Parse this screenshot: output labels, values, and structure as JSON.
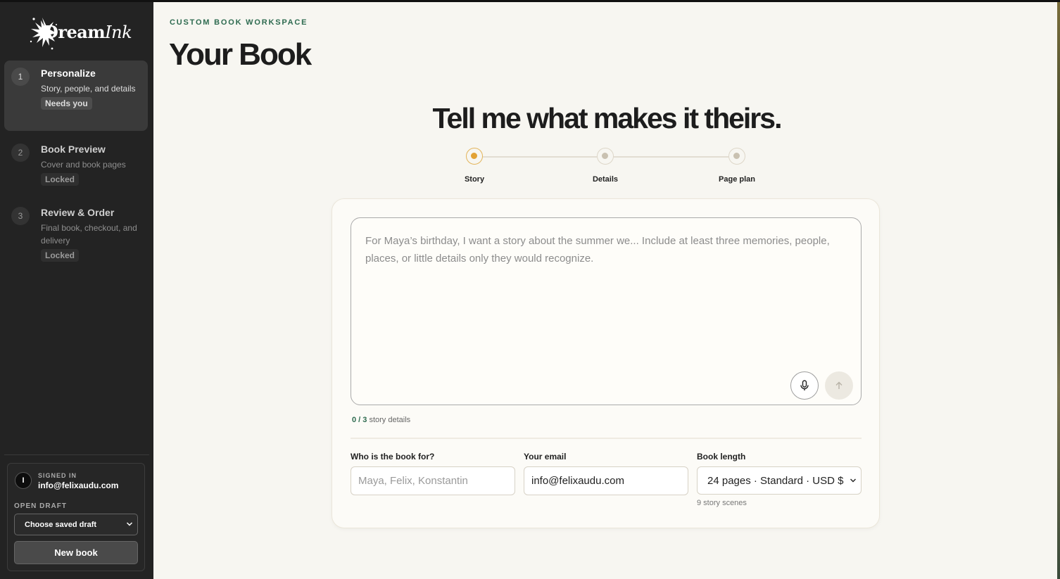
{
  "brand": {
    "name_bold": "Dream",
    "name_italic": "Ink"
  },
  "steps": [
    {
      "number": "1",
      "title": "Personalize",
      "desc": "Story, people, and details",
      "badge": "Needs you"
    },
    {
      "number": "2",
      "title": "Book Preview",
      "desc": "Cover and book pages",
      "badge": "Locked"
    },
    {
      "number": "3",
      "title": "Review & Order",
      "desc": "Final book, checkout, and delivery",
      "badge": "Locked"
    }
  ],
  "account": {
    "avatar_initial": "I",
    "signed_label": "SIGNED IN",
    "email": "info@felixaudu.com",
    "draft_label": "OPEN DRAFT",
    "draft_select_value": "Choose saved draft",
    "new_book_label": "New book"
  },
  "header": {
    "eyebrow": "CUSTOM BOOK WORKSPACE",
    "title": "Your Book"
  },
  "hero": "Tell me what makes it theirs.",
  "progress_steps": [
    {
      "label": "Story",
      "active": true
    },
    {
      "label": "Details",
      "active": false
    },
    {
      "label": "Page plan",
      "active": false
    }
  ],
  "story": {
    "placeholder": "For Maya’s birthday, I want a story about the summer we... Include at least three memories, people, places, or little details only they would recognize.",
    "count": "0 / 3",
    "count_suffix": "story details"
  },
  "fields": {
    "recipient_label": "Who is the book for?",
    "recipient_placeholder": "Maya, Felix, Konstantin",
    "email_label": "Your email",
    "email_value": "info@felixaudu.com",
    "length_label": "Book length",
    "length_value": "24 pages · Standard · USD $",
    "length_helper": "9 story scenes"
  },
  "colors": {
    "accent_green": "#2e6b50",
    "active_dot": "#e2a235",
    "sidebar_bg": "#232323",
    "main_bg": "#f7f6f1"
  },
  "icons": {
    "mic": "microphone-icon",
    "send": "arrow-up-icon",
    "chevron": "chevron-down-icon"
  }
}
